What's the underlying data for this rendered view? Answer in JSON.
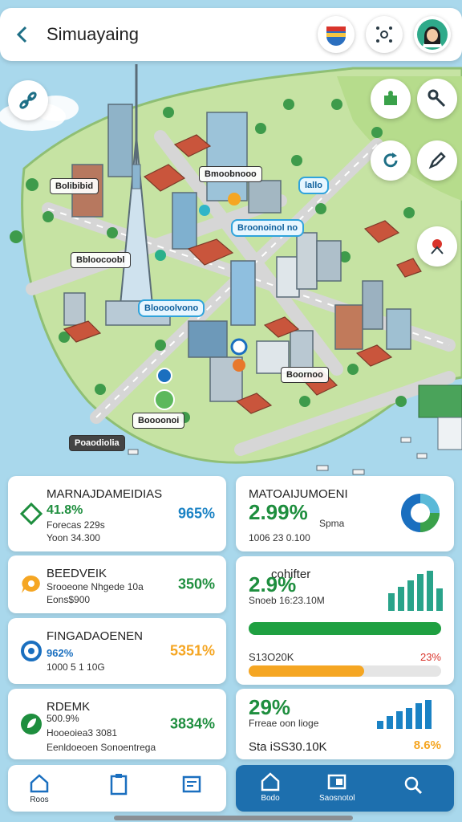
{
  "header": {
    "title": "Simuayaing",
    "back_icon": "chevron-left-icon",
    "actions": [
      "flag-badge-icon",
      "settings-dots-icon",
      "user-avatar"
    ]
  },
  "map": {
    "labels": [
      {
        "text": "Bolibibid",
        "style": "dark"
      },
      {
        "text": "Bmoobnooo",
        "style": "dark"
      },
      {
        "text": "lallo",
        "style": "blue"
      },
      {
        "text": "Broonoinol no",
        "style": "blue"
      },
      {
        "text": "Bbloocoobl",
        "style": "dark"
      },
      {
        "text": "Bloooolvono",
        "style": "blue"
      },
      {
        "text": "Boornoo",
        "style": "dark"
      },
      {
        "text": "Boooonoi",
        "style": "dark"
      },
      {
        "text": "Poaodiolia",
        "style": "dark"
      }
    ],
    "buttons": [
      "link-icon",
      "puzzle-icon",
      "wrench-icon",
      "refresh-icon",
      "edit-icon",
      "location-pin-icon"
    ],
    "colors": {
      "water": "#a9d8ec",
      "land": "#c6e3a3",
      "road": "#d9d9d9"
    }
  },
  "left_cards": [
    {
      "title": "MARNAJDAMEIDIAS",
      "line1": "41.8%",
      "line2": "Forecas 229s",
      "line3": "Yoon 34.300",
      "pct": "965%",
      "pct_color": "#1a82c4",
      "icon": "diamond-icon",
      "icon_color": "#1e8e3e"
    },
    {
      "title": "BEEDVEIK",
      "line1": "Srooeone Nhgede 10a",
      "line2": "Eons$900",
      "line3": "",
      "pct": "350%",
      "pct_color": "#1e8e3e",
      "icon": "chat-bubble-icon",
      "icon_color": "#f5a623"
    },
    {
      "title": "FINGADAOENEN",
      "line1": "962%",
      "line2": "1000 5 1 10G",
      "line3": "",
      "pct": "5351%",
      "pct_color": "#f5a623",
      "icon": "ring-icon",
      "icon_color": "#1a6fbf"
    },
    {
      "title": "RDEMK",
      "line1": "500.9%",
      "line2": "Hooeoiea3 3081",
      "line3": "Eenldoeoen Sonoentrega",
      "pct": "3834%",
      "pct_color": "#1e8e3e",
      "icon": "leaf-icon",
      "icon_color": "#1e8e3e"
    }
  ],
  "right_cards": {
    "card1": {
      "title": "MATOAIJUMOENI",
      "big": "2.99%",
      "small1": "Spma",
      "small2": "1006 23 0.100"
    },
    "card2": {
      "title": "cohifter",
      "big": "2.9%",
      "small1": "Snoeb 16:23.10M",
      "progress_green": 1.0,
      "progress_orange": 0.6,
      "bar_label": "S13O20K",
      "bar_pct": "23%"
    },
    "card3": {
      "big": "29%",
      "small1": "Frreae oon lioge",
      "footer": "Sta iSS30.10K",
      "footer_pct": "8.6%"
    }
  },
  "nav_left": [
    {
      "label": "Roos",
      "icon": "home-icon"
    },
    {
      "label": "",
      "icon": "clipboard-icon"
    },
    {
      "label": "",
      "icon": "report-icon"
    }
  ],
  "nav_right": [
    {
      "label": "Bodo",
      "icon": "home-icon"
    },
    {
      "label": "Saosnotol",
      "icon": "folder-icon"
    },
    {
      "label": "",
      "icon": "search-icon"
    }
  ]
}
